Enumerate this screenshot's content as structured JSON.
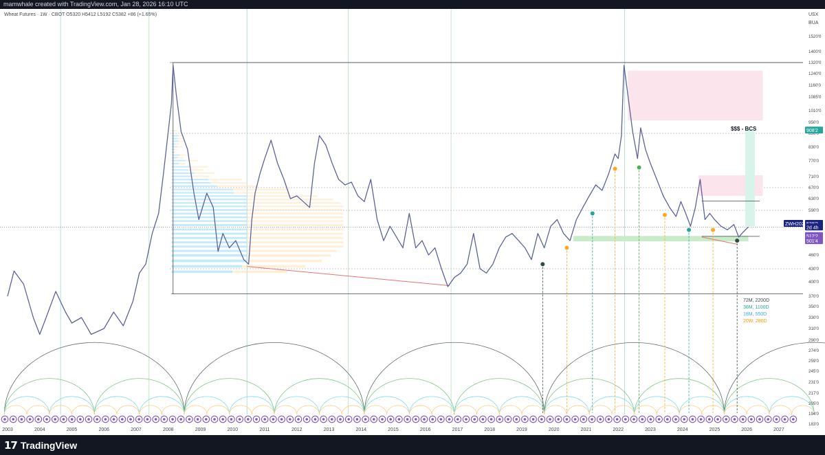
{
  "header": {
    "watermark": "mamwhale created with TradingView.com, Jan 28, 2026 16:10 UTC"
  },
  "chart_data": {
    "type": "line",
    "instrument_line": "Wheat Futures · 1W · CBOT  O5320  H5412  L5192  C5382  +86 (+1.65%)",
    "currency": "USX",
    "session_label": "BUA",
    "x_labels": [
      "2003",
      "2004",
      "2005",
      "2006",
      "2007",
      "2008",
      "2009",
      "2010",
      "2011",
      "2012",
      "2013",
      "2014",
      "2015",
      "2016",
      "2017",
      "2018",
      "2019",
      "2020",
      "2021",
      "2022",
      "2023",
      "2024",
      "2025",
      "2026",
      "2027"
    ],
    "y_labels": [
      "1520'0",
      "1400'0",
      "1320'0",
      "1240'0",
      "1160'0",
      "1085'0",
      "1010'0",
      "950'0",
      "890'0",
      "830'0",
      "770'0",
      "710'0",
      "670'0",
      "630'0",
      "590'0",
      "550'0",
      "460'0",
      "430'0",
      "400'0",
      "370'0",
      "350'0",
      "330'0",
      "310'0",
      "290'0",
      "274'0",
      "259'0",
      "245'0",
      "231'0",
      "217'0",
      "205'0",
      "194'0",
      "183'0"
    ],
    "price_ohlc": {
      "open": 532.0,
      "high": 541.2,
      "low": 519.2,
      "close": 538.2,
      "change": 8.6,
      "change_pct": 1.65
    },
    "price_tags": {
      "target": "908'2",
      "symbol": "ZWH2026",
      "last": "538'2",
      "countdown": "2d 4h",
      "level_a": "512'2",
      "level_b": "501'4"
    },
    "annotation_text": "$$$ - BCS",
    "cycle_legend": [
      {
        "label": "72M, 2200D",
        "color": "#434651"
      },
      {
        "label": "36M, 1100D",
        "color": "#26a69a"
      },
      {
        "label": "18M, 550D",
        "color": "#42a5f5"
      },
      {
        "label": "20W, 280D",
        "color": "#ff9800"
      }
    ],
    "series": [
      {
        "values": [
          [
            2003.0,
            370
          ],
          [
            2003.2,
            425
          ],
          [
            2003.5,
            395
          ],
          [
            2003.8,
            330
          ],
          [
            2004.0,
            300
          ],
          [
            2004.2,
            330
          ],
          [
            2004.5,
            380
          ],
          [
            2004.8,
            340
          ],
          [
            2005.0,
            320
          ],
          [
            2005.3,
            330
          ],
          [
            2005.6,
            300
          ],
          [
            2006.0,
            310
          ],
          [
            2006.3,
            340
          ],
          [
            2006.6,
            315
          ],
          [
            2006.9,
            360
          ],
          [
            2007.1,
            420
          ],
          [
            2007.3,
            440
          ],
          [
            2007.5,
            520
          ],
          [
            2007.7,
            580
          ],
          [
            2007.85,
            720
          ],
          [
            2008.0,
            900
          ],
          [
            2008.1,
            1050
          ],
          [
            2008.15,
            1300
          ],
          [
            2008.25,
            1100
          ],
          [
            2008.4,
            900
          ],
          [
            2008.6,
            820
          ],
          [
            2008.8,
            650
          ],
          [
            2008.95,
            560
          ],
          [
            2009.2,
            650
          ],
          [
            2009.4,
            600
          ],
          [
            2009.55,
            470
          ],
          [
            2009.7,
            520
          ],
          [
            2009.9,
            480
          ],
          [
            2010.1,
            500
          ],
          [
            2010.35,
            450
          ],
          [
            2010.5,
            440
          ],
          [
            2010.6,
            560
          ],
          [
            2010.7,
            650
          ],
          [
            2010.85,
            720
          ],
          [
            2011.0,
            780
          ],
          [
            2011.2,
            860
          ],
          [
            2011.4,
            760
          ],
          [
            2011.6,
            700
          ],
          [
            2011.8,
            630
          ],
          [
            2012.0,
            640
          ],
          [
            2012.2,
            620
          ],
          [
            2012.4,
            600
          ],
          [
            2012.55,
            760
          ],
          [
            2012.7,
            880
          ],
          [
            2012.9,
            840
          ],
          [
            2013.1,
            760
          ],
          [
            2013.3,
            700
          ],
          [
            2013.5,
            680
          ],
          [
            2013.7,
            690
          ],
          [
            2013.9,
            640
          ],
          [
            2014.1,
            620
          ],
          [
            2014.3,
            700
          ],
          [
            2014.5,
            560
          ],
          [
            2014.7,
            500
          ],
          [
            2014.9,
            540
          ],
          [
            2015.1,
            510
          ],
          [
            2015.3,
            480
          ],
          [
            2015.5,
            580
          ],
          [
            2015.7,
            480
          ],
          [
            2015.9,
            500
          ],
          [
            2016.1,
            460
          ],
          [
            2016.3,
            480
          ],
          [
            2016.5,
            430
          ],
          [
            2016.7,
            390
          ],
          [
            2016.9,
            410
          ],
          [
            2017.1,
            420
          ],
          [
            2017.3,
            440
          ],
          [
            2017.5,
            520
          ],
          [
            2017.7,
            430
          ],
          [
            2017.9,
            420
          ],
          [
            2018.1,
            440
          ],
          [
            2018.3,
            480
          ],
          [
            2018.5,
            510
          ],
          [
            2018.7,
            520
          ],
          [
            2018.9,
            500
          ],
          [
            2019.1,
            480
          ],
          [
            2019.3,
            450
          ],
          [
            2019.5,
            520
          ],
          [
            2019.7,
            480
          ],
          [
            2019.9,
            540
          ],
          [
            2020.1,
            560
          ],
          [
            2020.3,
            520
          ],
          [
            2020.5,
            500
          ],
          [
            2020.7,
            560
          ],
          [
            2020.9,
            600
          ],
          [
            2021.1,
            640
          ],
          [
            2021.3,
            680
          ],
          [
            2021.5,
            660
          ],
          [
            2021.7,
            720
          ],
          [
            2021.9,
            800
          ],
          [
            2022.0,
            780
          ],
          [
            2022.1,
            880
          ],
          [
            2022.18,
            1300
          ],
          [
            2022.3,
            1100
          ],
          [
            2022.45,
            900
          ],
          [
            2022.6,
            780
          ],
          [
            2022.7,
            920
          ],
          [
            2022.85,
            820
          ],
          [
            2023.0,
            760
          ],
          [
            2023.2,
            700
          ],
          [
            2023.4,
            640
          ],
          [
            2023.6,
            600
          ],
          [
            2023.8,
            570
          ],
          [
            2023.95,
            620
          ],
          [
            2024.1,
            580
          ],
          [
            2024.25,
            540
          ],
          [
            2024.4,
            600
          ],
          [
            2024.55,
            700
          ],
          [
            2024.7,
            560
          ],
          [
            2024.85,
            580
          ],
          [
            2025.0,
            560
          ],
          [
            2025.2,
            540
          ],
          [
            2025.4,
            530
          ],
          [
            2025.6,
            545
          ],
          [
            2025.75,
            510
          ],
          [
            2025.9,
            525
          ],
          [
            2026.05,
            538
          ]
        ]
      }
    ],
    "cycle_dates": [
      2008.5,
      2014.1,
      2019.65,
      2025.7
    ],
    "xlim": [
      2002.85,
      2027.75
    ],
    "ylim": [
      183,
      1520
    ]
  }
}
